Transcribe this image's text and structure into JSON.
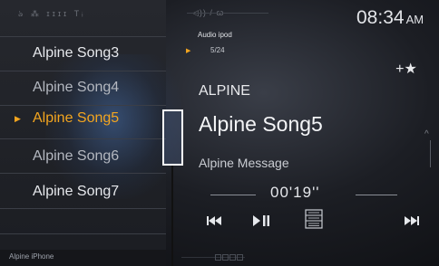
{
  "status": {
    "icons_text": "ঌ ⁂ ɪɪɪɪ Tᵢ"
  },
  "playlist": {
    "items": [
      {
        "label": "Alpine Song3",
        "state": "normal"
      },
      {
        "label": "Alpine Song4",
        "state": "dim"
      },
      {
        "label": "Alpine Song5",
        "state": "active"
      },
      {
        "label": "Alpine Song6",
        "state": "dim"
      },
      {
        "label": "Alpine Song7",
        "state": "normal"
      }
    ],
    "device_name": "Alpine iPhone"
  },
  "header": {
    "volume_text": "◁)) / ꞷ",
    "clock_time": "08:34",
    "clock_ampm": "AM"
  },
  "now_playing": {
    "source": "Audio ipod",
    "track_count": "5/24",
    "artist": "ALPINE",
    "title": "Alpine Song5",
    "album": "Alpine Message",
    "elapsed": "00'19''",
    "favorite_label": "+★"
  },
  "controls": {
    "prev_icon": "skip-previous-icon",
    "play_pause_icon": "play-pause-icon",
    "browse_icon": "browse-mode-icon",
    "next_icon": "skip-next-icon"
  },
  "colors": {
    "accent": "#f3a51f",
    "text": "#e6e8ec",
    "callout": "#ffffff"
  }
}
